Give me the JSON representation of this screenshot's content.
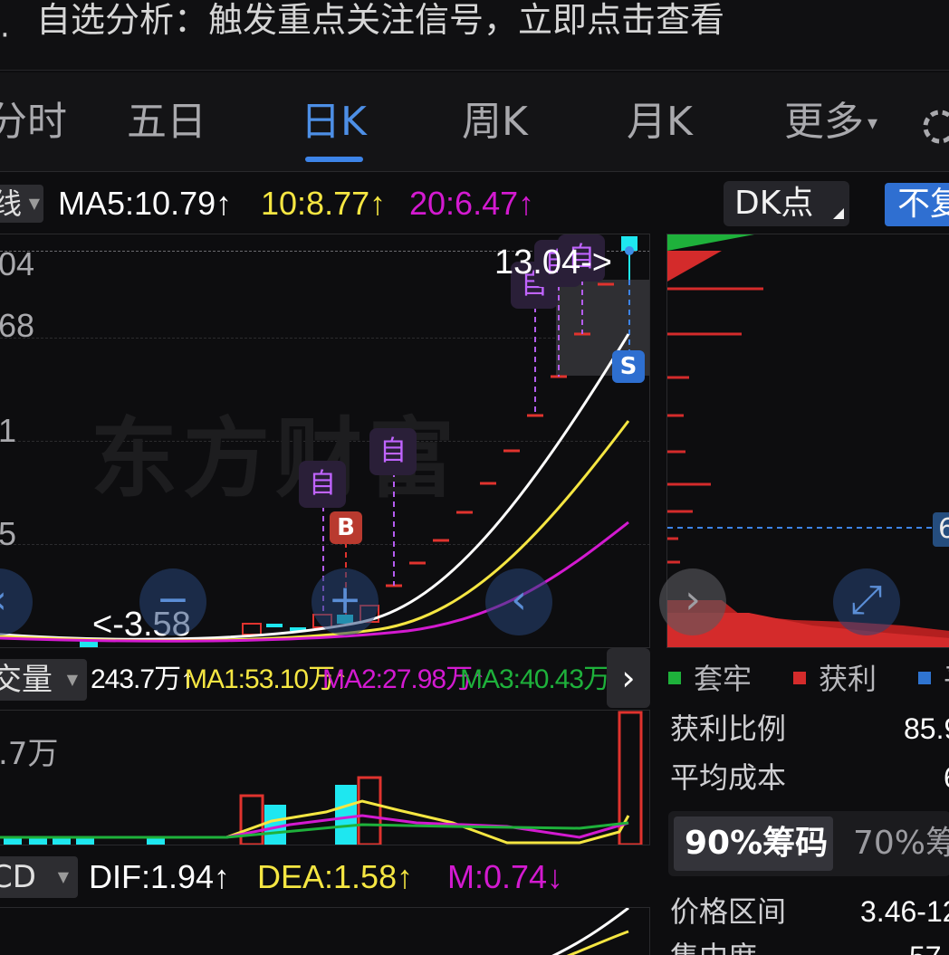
{
  "banner": {
    "bullet": "·",
    "text": "自选分析：触发重点关注信号，立即点击查看"
  },
  "tabs": [
    {
      "label": "分时",
      "active": false
    },
    {
      "label": "五日",
      "active": false
    },
    {
      "label": "日K",
      "active": true
    },
    {
      "label": "周K",
      "active": false
    },
    {
      "label": "月K",
      "active": false
    },
    {
      "label": "更多",
      "active": false
    }
  ],
  "ma_bar": {
    "selector": "线",
    "ma5": "MA5:10.79↑",
    "ma10": "10:8.77↑",
    "ma20": "20:6.47↑",
    "dk_button": "DK点",
    "fuquan_button": "不复"
  },
  "colors": {
    "white_line": "#ffffff",
    "yellow_line": "#f5e642",
    "magenta_line": "#d31ad0",
    "up_red": "#e0332e",
    "down_cyan": "#1ee7f0",
    "accent_blue": "#3d84e8",
    "green": "#1eb13b"
  },
  "price_chart": {
    "y_axis_labels": [
      "04",
      "68",
      "1",
      "5"
    ],
    "max_label": "13.04->",
    "min_label": "<-3.58",
    "watermark": "东方财富",
    "signal_markers": [
      "自",
      "自",
      "自",
      "自",
      "自"
    ],
    "buy_marker": "B",
    "sell_marker": "S"
  },
  "chip_panel": {
    "current_price_tag": "6"
  },
  "nav_icons": [
    "chevron-left-icon",
    "zoom-out-icon",
    "zoom-in-icon",
    "pan-left-icon",
    "pan-right-icon",
    "fullscreen-icon"
  ],
  "volume": {
    "selector": "交量",
    "value": "243.7万↑",
    "ma1": "MA1:53.10万↑",
    "ma2": "MA2:27.98万↑",
    "ma3": "MA3:40.43万↑",
    "y_label": ".7万"
  },
  "macd": {
    "selector": "CD",
    "dif": "DIF:1.94↑",
    "dea": "DEA:1.58↑",
    "m": "M:0.74↓"
  },
  "chip_legend": [
    {
      "label": "套牢",
      "color": "#1eb13b"
    },
    {
      "label": "获利",
      "color": "#d42b2b"
    },
    {
      "label": "平",
      "color": "#2f74d0"
    }
  ],
  "chip_stats": [
    {
      "label": "获利比例",
      "value": "85.9"
    },
    {
      "label": "平均成本",
      "value": "6"
    }
  ],
  "chip_tabs": [
    {
      "label": "90%筹码",
      "active": true
    },
    {
      "label": "70%筹",
      "active": false
    }
  ],
  "chip_range": [
    {
      "label": "价格区间",
      "value": "3.46-12"
    },
    {
      "label": "集中度",
      "value": "57"
    }
  ]
}
